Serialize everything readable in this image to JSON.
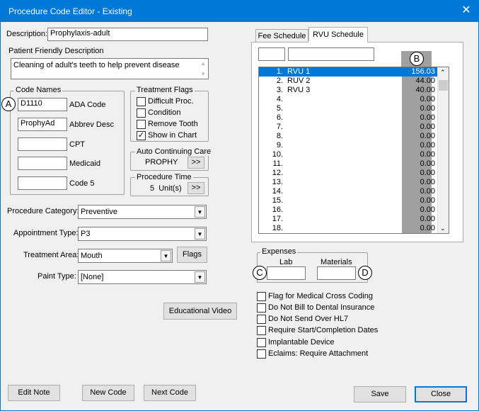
{
  "window": {
    "title": "Procedure Code Editor - Existing",
    "close_glyph": "✕"
  },
  "description": {
    "label": "Description:",
    "value": "Prophylaxis-adult"
  },
  "patient_friendly": {
    "label": "Patient Friendly Description",
    "value": "Cleaning of adult's teeth to help prevent disease"
  },
  "code_names": {
    "legend": "Code Names",
    "ada_value": "D1110",
    "ada_label": "ADA Code",
    "abbrev_value": "ProphyAd",
    "abbrev_label": "Abbrev Desc",
    "cpt_value": "",
    "cpt_label": "CPT",
    "medicaid_value": "",
    "medicaid_label": "Medicaid",
    "code5_value": "",
    "code5_label": "Code 5"
  },
  "treatment_flags": {
    "legend": "Treatment Flags",
    "items": [
      {
        "label": "Difficult Proc.",
        "checked": ""
      },
      {
        "label": "Condition",
        "checked": ""
      },
      {
        "label": "Remove Tooth",
        "checked": ""
      },
      {
        "label": "Show in Chart",
        "checked": "✓"
      }
    ]
  },
  "auto_care": {
    "legend": "Auto Continuing Care",
    "value": "PROPHY",
    "button": ">>"
  },
  "proc_time": {
    "legend": "Procedure Time",
    "value": "5  Unit(s)",
    "button": ">>"
  },
  "category": {
    "label": "Procedure Category:",
    "value": "Preventive"
  },
  "appointment": {
    "label": "Appointment Type:",
    "value": "P3"
  },
  "treatment_area": {
    "label": "Treatment Area:",
    "value": "Mouth",
    "flags_button": "Flags"
  },
  "paint_type": {
    "label": "Paint Type:",
    "value": "[None]"
  },
  "educational_video": "Educational Video",
  "tabs": [
    {
      "label": "Fee Schedule"
    },
    {
      "label": "RVU Schedule"
    }
  ],
  "rvu": {
    "rows": [
      {
        "num": "1.",
        "name": "RVU 1",
        "amount": "156.03"
      },
      {
        "num": "2.",
        "name": "RUV 2",
        "amount": "44.00"
      },
      {
        "num": "3.",
        "name": "RVU 3",
        "amount": "40.00"
      },
      {
        "num": "4.",
        "name": "",
        "amount": "0.00"
      },
      {
        "num": "5.",
        "name": "",
        "amount": "0.00"
      },
      {
        "num": "6.",
        "name": "",
        "amount": "0.00"
      },
      {
        "num": "7.",
        "name": "",
        "amount": "0.00"
      },
      {
        "num": "8.",
        "name": "",
        "amount": "0.00"
      },
      {
        "num": "9.",
        "name": "",
        "amount": "0.00"
      },
      {
        "num": "10.",
        "name": "",
        "amount": "0.00"
      },
      {
        "num": "11.",
        "name": "",
        "amount": "0.00"
      },
      {
        "num": "12.",
        "name": "",
        "amount": "0.00"
      },
      {
        "num": "13.",
        "name": "",
        "amount": "0.00"
      },
      {
        "num": "14.",
        "name": "",
        "amount": "0.00"
      },
      {
        "num": "15.",
        "name": "",
        "amount": "0.00"
      },
      {
        "num": "16.",
        "name": "",
        "amount": "0.00"
      },
      {
        "num": "17.",
        "name": "",
        "amount": "0.00"
      },
      {
        "num": "18.",
        "name": "",
        "amount": "0.00"
      }
    ]
  },
  "expenses": {
    "legend": "Expenses",
    "lab_label": "Lab",
    "lab_value": "",
    "materials_label": "Materials",
    "materials_value": ""
  },
  "options": [
    {
      "label": "Flag for Medical Cross Coding",
      "checked": ""
    },
    {
      "label": "Do Not Bill to Dental Insurance",
      "checked": ""
    },
    {
      "label": "Do Not Send Over HL7",
      "checked": ""
    },
    {
      "label": "Require Start/Completion Dates",
      "checked": ""
    },
    {
      "label": "Implantable Device",
      "checked": ""
    },
    {
      "label": "Eclaims: Require Attachment",
      "checked": ""
    }
  ],
  "markers": {
    "a": "A",
    "b": "B",
    "c": "C",
    "d": "D"
  },
  "buttons": {
    "edit_note": "Edit Note",
    "new_code": "New Code",
    "next_code": "Next Code",
    "save": "Save",
    "close": "Close"
  },
  "colors": {
    "title_bar": "#0078d7",
    "selection": "#0078d7",
    "amount_column": "#a0a0a0"
  }
}
